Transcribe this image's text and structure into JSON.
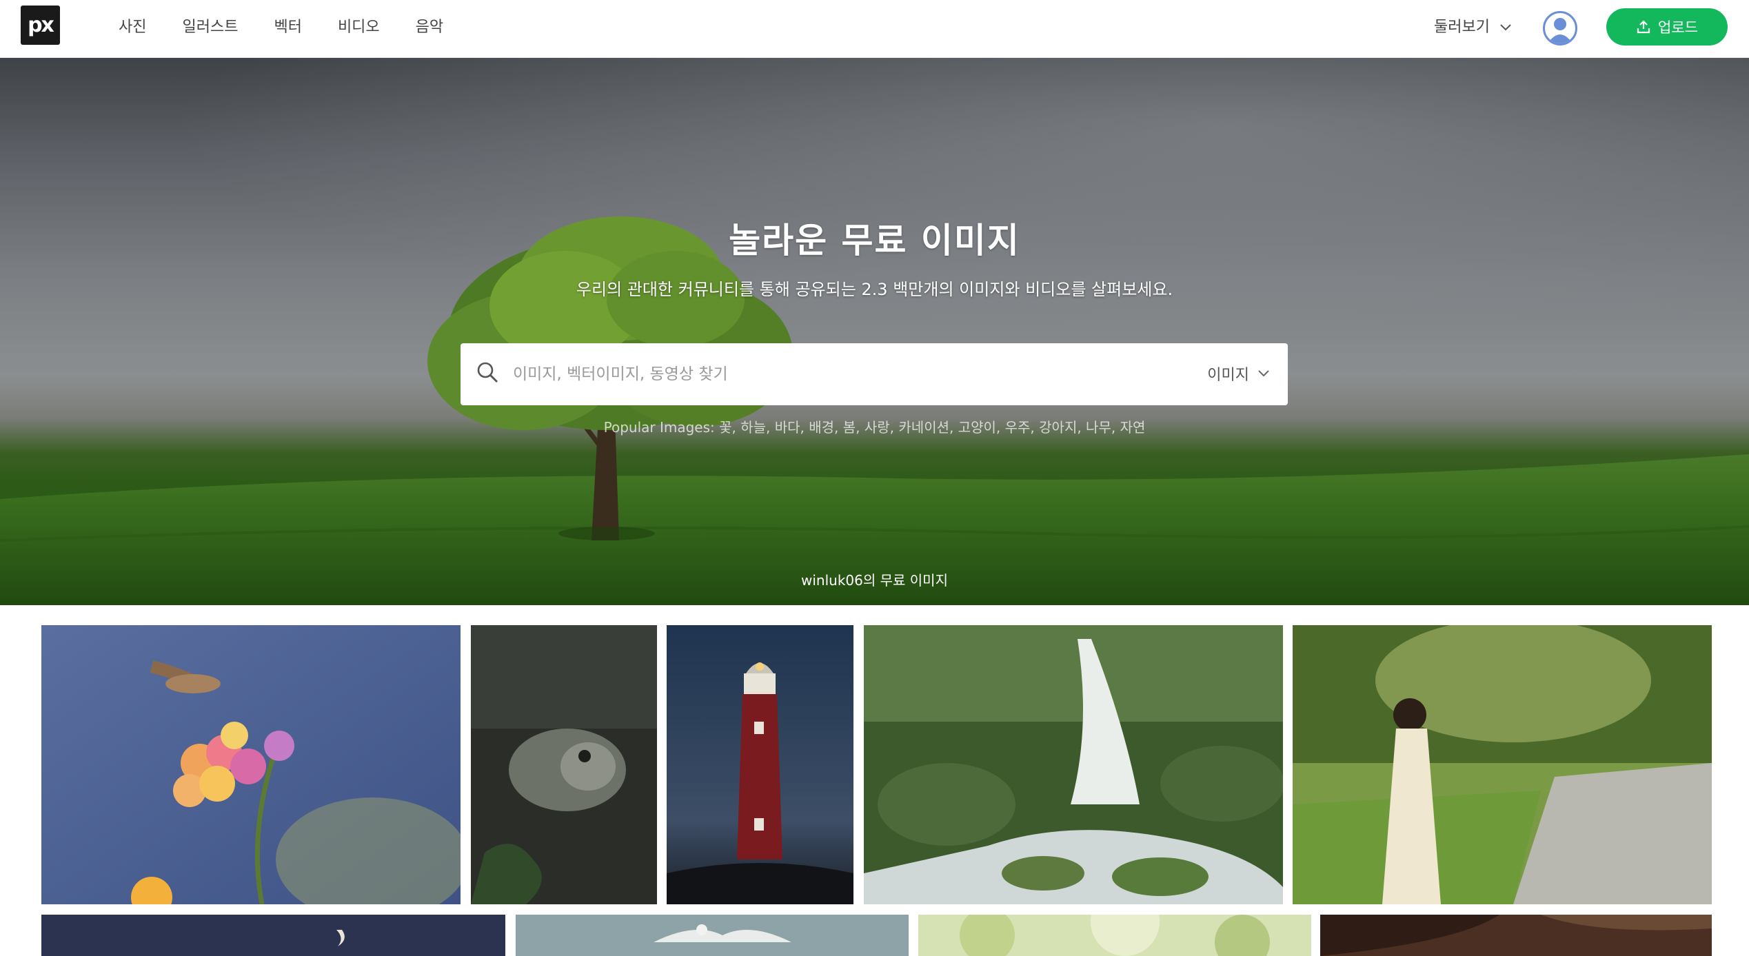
{
  "nav": {
    "logo": "px",
    "links": [
      "사진",
      "일러스트",
      "벡터",
      "비디오",
      "음악"
    ],
    "explore": "둘러보기",
    "upload": "업로드"
  },
  "hero": {
    "title": "놀라운 무료 이미지",
    "subtitle": "우리의 관대한 커뮤니티를 통해 공유되는 2.3 백만개의 이미지와 비디오를 살펴보세요.",
    "search_placeholder": "이미지, 벡터이미지, 동영상 찾기",
    "search_type": "이미지",
    "popular": "Popular Images: 꽃, 하늘, 바다, 배경, 봄, 사랑, 카네이션, 고양이, 우주, 강아지, 나무, 자연",
    "credit": "winluk06의 무료 이미지"
  },
  "gallery": {
    "row1": [
      "hummingbird-moth-flower",
      "fish",
      "lighthouse",
      "waterfall",
      "woman-in-park"
    ],
    "row2": [
      "night-sky-moon",
      "seagull",
      "green-bokeh",
      "brown-fur"
    ]
  },
  "colors": {
    "brand": "#13b75c",
    "nav_text": "#444444"
  }
}
